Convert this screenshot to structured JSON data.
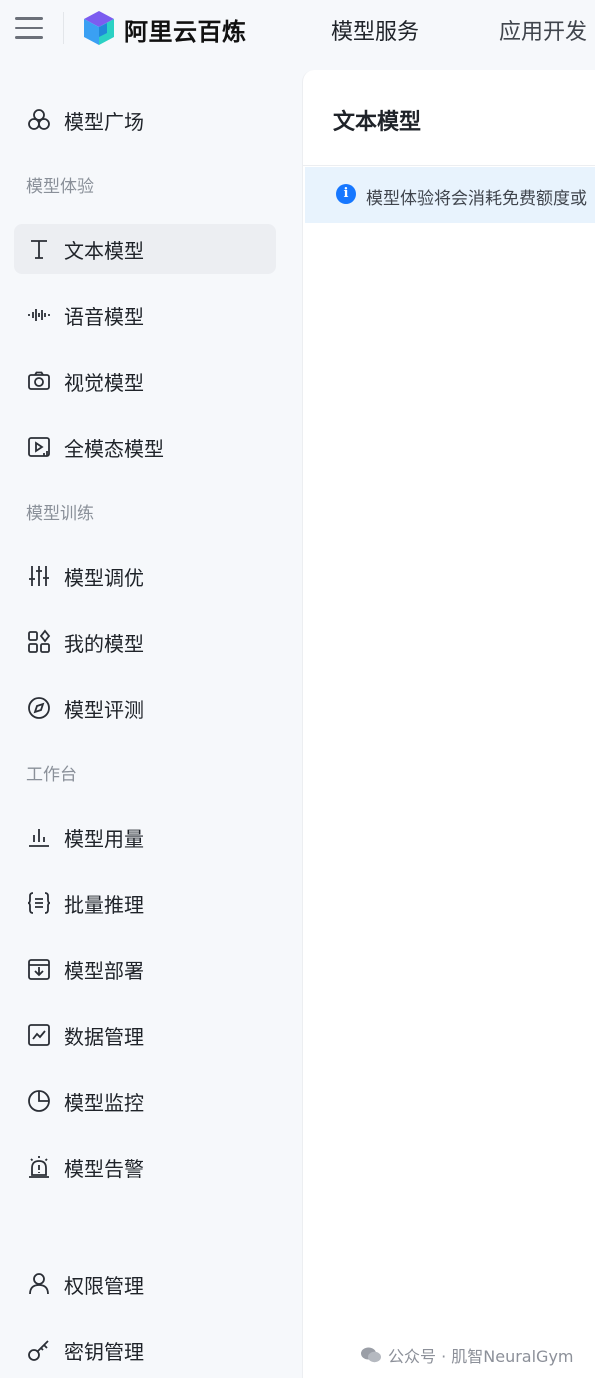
{
  "header": {
    "brand": "阿里云百炼",
    "nav": [
      "模型服务",
      "应用开发"
    ]
  },
  "sidebar": {
    "top_item": {
      "label": "模型广场",
      "icon": "model-plaza-icon"
    },
    "sections": [
      {
        "title": "模型体验",
        "items": [
          {
            "label": "文本模型",
            "icon": "text-icon",
            "active": true
          },
          {
            "label": "语音模型",
            "icon": "waveform-icon"
          },
          {
            "label": "视觉模型",
            "icon": "camera-icon"
          },
          {
            "label": "全模态模型",
            "icon": "video-play-icon"
          }
        ]
      },
      {
        "title": "模型训练",
        "items": [
          {
            "label": "模型调优",
            "icon": "sliders-icon"
          },
          {
            "label": "我的模型",
            "icon": "apps-grid-icon"
          },
          {
            "label": "模型评测",
            "icon": "compass-icon"
          }
        ]
      },
      {
        "title": "工作台",
        "items": [
          {
            "label": "模型用量",
            "icon": "bar-chart-icon"
          },
          {
            "label": "批量推理",
            "icon": "braces-list-icon"
          },
          {
            "label": "模型部署",
            "icon": "deploy-box-icon"
          },
          {
            "label": "数据管理",
            "icon": "line-chart-icon"
          },
          {
            "label": "模型监控",
            "icon": "pie-chart-icon"
          },
          {
            "label": "模型告警",
            "icon": "alarm-icon"
          }
        ]
      }
    ],
    "bottom_items": [
      {
        "label": "权限管理",
        "icon": "user-icon"
      },
      {
        "label": "密钥管理",
        "icon": "key-icon"
      }
    ]
  },
  "main": {
    "title": "文本模型",
    "notice": "模型体验将会消耗免费额度或"
  },
  "watermark": "公众号 · 肌智NeuralGym",
  "colors": {
    "background": "#f6f8fb",
    "active_item": "#eceef2",
    "notice_bg": "#e8f3fd",
    "info_blue": "#1677ff"
  }
}
